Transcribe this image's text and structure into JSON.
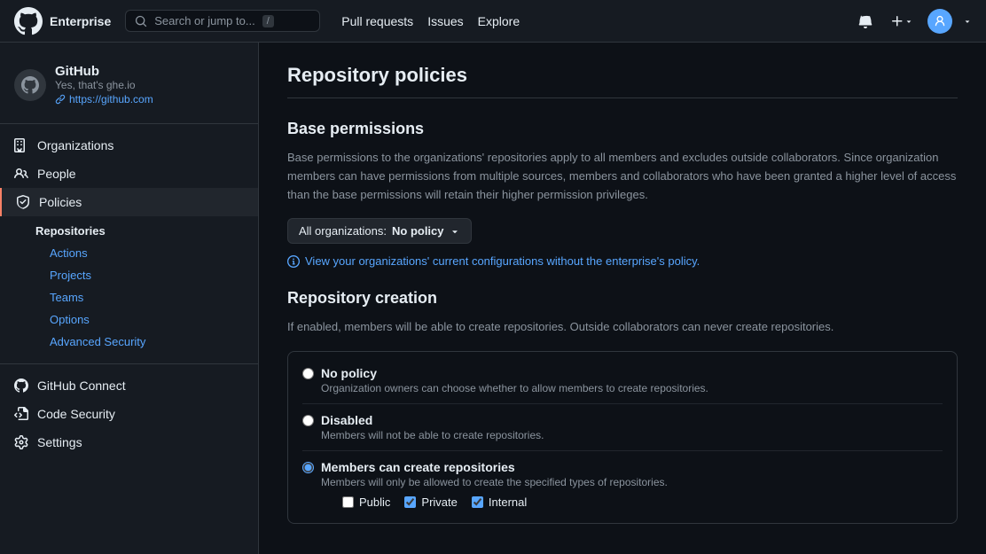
{
  "topnav": {
    "logo_text": "Enterprise",
    "search_placeholder": "Search or jump to...",
    "search_kbd": "/",
    "links": [
      {
        "label": "Pull requests",
        "href": "#"
      },
      {
        "label": "Issues",
        "href": "#"
      },
      {
        "label": "Explore",
        "href": "#"
      }
    ]
  },
  "sidebar": {
    "org_name": "GitHub",
    "org_sub": "Yes, that's ghe.io",
    "org_link": "https://github.com",
    "nav_items": [
      {
        "label": "Organizations",
        "id": "organizations"
      },
      {
        "label": "People",
        "id": "people"
      },
      {
        "label": "Policies",
        "id": "policies",
        "active": true
      }
    ],
    "sub_items": {
      "section_label": "Repositories",
      "links": [
        "Actions",
        "Projects",
        "Teams",
        "Options",
        "Advanced Security"
      ]
    },
    "bottom_items": [
      {
        "label": "GitHub Connect",
        "id": "github-connect"
      },
      {
        "label": "Code Security",
        "id": "code-security"
      },
      {
        "label": "Settings",
        "id": "settings"
      }
    ]
  },
  "content": {
    "page_title": "Repository policies",
    "base_permissions": {
      "title": "Base permissions",
      "description": "Base permissions to the organizations' repositories apply to all members and excludes outside collaborators. Since organization members can have permissions from multiple sources, members and collaborators who have been granted a higher level of access than the base permissions will retain their higher permission privileges.",
      "dropdown_label": "All organizations:",
      "dropdown_value": "No policy",
      "info_link": "View your organizations' current configurations without the enterprise's policy."
    },
    "repository_creation": {
      "title": "Repository creation",
      "description": "If enabled, members will be able to create repositories. Outside collaborators can never create repositories.",
      "options": [
        {
          "id": "no-policy",
          "label": "No policy",
          "desc": "Organization owners can choose whether to allow members to create repositories.",
          "checked": false
        },
        {
          "id": "disabled",
          "label": "Disabled",
          "desc": "Members will not be able to create repositories.",
          "checked": false
        },
        {
          "id": "members-can-create",
          "label": "Members can create repositories",
          "desc": "Members will only be allowed to create the specified types of repositories.",
          "checked": true
        }
      ],
      "checkboxes": [
        {
          "id": "public",
          "label": "Public",
          "checked": false
        },
        {
          "id": "private",
          "label": "Private",
          "checked": true
        },
        {
          "id": "internal",
          "label": "Internal",
          "checked": true
        }
      ]
    }
  }
}
